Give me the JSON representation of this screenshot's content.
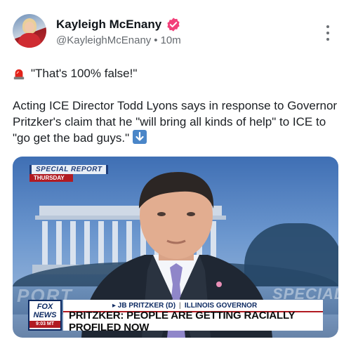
{
  "post": {
    "author": {
      "display_name": "Kayleigh McEnany",
      "handle": "@KayleighMcEnany",
      "separator": "•",
      "time": "10m",
      "verified": true,
      "verified_color": "#f2407a"
    },
    "more_icon": "vertical-ellipsis-icon",
    "text": {
      "quote_icon": "rotating-light-icon",
      "quote": "\"That's 100% false!\"",
      "body": "Acting ICE Director Todd Lyons says in response to Governor Pritzker's claim that he \"will bring all kinds of help\" to ICE to \"go get the bad guys.\"",
      "trailing_icon": "down-arrow-icon"
    },
    "media": {
      "special_report": "SPECIAL REPORT",
      "day": "THURSDAY",
      "logo_line1": "FOX",
      "logo_line2": "NEWS",
      "logo_time": "9:03 MT",
      "name_prefix": "▸ JB PRITZKER (D)",
      "name_separator": "|",
      "name_title": "ILLINOIS GOVERNOR",
      "headline": "PRITZKER: PEOPLE ARE GETTING RACIALLY PROFILED NOW",
      "background_left_word": "PORT",
      "background_right_word": "SPECIAL"
    }
  },
  "colors": {
    "text_primary": "#0f1419",
    "text_secondary": "#666b70",
    "fox_red": "#b11b22",
    "fox_navy": "#0d2a62"
  }
}
